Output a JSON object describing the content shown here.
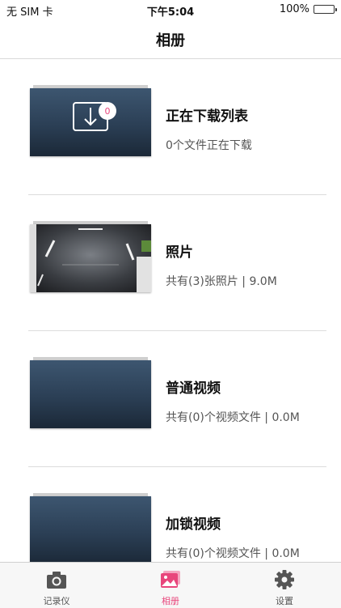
{
  "status_bar": {
    "carrier": "无 SIM 卡",
    "time": "下午5:04",
    "battery_percent": "100%",
    "battery_level": 1.0
  },
  "nav": {
    "title": "相册"
  },
  "albums": [
    {
      "title": "正在下载列表",
      "subtitle": "0个文件正在下载",
      "badge": "0",
      "thumbnail": "download-icon"
    },
    {
      "title": "照片",
      "subtitle": "共有(3)张照片 | 9.0M",
      "thumbnail": "photo-preview"
    },
    {
      "title": "普通视频",
      "subtitle": "共有(0)个视频文件 | 0.0M",
      "thumbnail": "empty"
    },
    {
      "title": "加锁视频",
      "subtitle": "共有(0)个视频文件 | 0.0M",
      "thumbnail": "empty"
    }
  ],
  "tabs": [
    {
      "label": "记录仪",
      "icon": "camera-icon",
      "active": false
    },
    {
      "label": "相册",
      "icon": "album-icon",
      "active": true
    },
    {
      "label": "设置",
      "icon": "gear-icon",
      "active": false
    }
  ],
  "colors": {
    "accent": "#e8467c",
    "battery": "#3cc845",
    "divider": "#dcdcdc"
  }
}
